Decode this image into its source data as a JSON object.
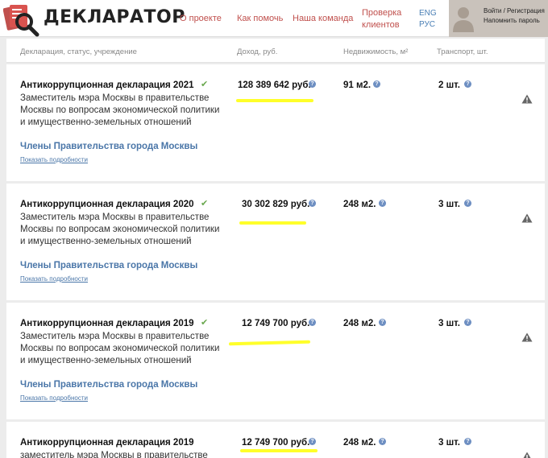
{
  "header": {
    "logo_text": "ДЕКЛАРАТОР",
    "nav": [
      "О проекте",
      "Как помочь",
      "Наша команда",
      "Проверка клиентов"
    ],
    "lang": [
      "ENG",
      "РУС"
    ],
    "login": "Войти / Регистрация",
    "remind": "Напомнить пароль",
    "colors": {
      "nav": "#c0504d",
      "lang": "#4a7fb5",
      "user_box": "#c9c2bb"
    }
  },
  "table": {
    "columns": [
      "Декларация, статус, учреждение",
      "Доход, руб.",
      "Недвижимость, м²",
      "Транспорт, шт."
    ],
    "rows": [
      {
        "title": "Антикоррупционная декларация 2021",
        "verified": "✔",
        "desc": "Заместитель мэра Москвы в правительстве Москвы по вопросам экономической политики и имущественно-земельных отношений",
        "group": "Члены Правительства города Москвы",
        "more": "Показать подробности",
        "income": "128 389 642 руб.",
        "realty": "91 м2.",
        "transport": "2 шт."
      },
      {
        "title": "Антикоррупционная декларация 2020",
        "verified": "✔",
        "desc": "Заместитель мэра Москвы в правительстве Москвы по вопросам экономической политики и имущественно-земельных отношений",
        "group": "Члены Правительства города Москвы",
        "more": "Показать подробности",
        "income": "30 302 829 руб.",
        "realty": "248 м2.",
        "transport": "3 шт."
      },
      {
        "title": "Антикоррупционная декларация 2019",
        "verified": "✔",
        "desc": "Заместитель мэра Москвы в правительстве Москвы по вопросам экономической политики и имущественно-земельных отношений",
        "group": "Члены Правительства города Москвы",
        "more": "Показать подробности",
        "income": "12 749 700 руб.",
        "realty": "248 м2.",
        "transport": "3 шт."
      },
      {
        "title": "Антикоррупционная декларация 2019",
        "desc_first_line": "заместитель мэра Москвы в правительстве",
        "income": "12 749 700 руб.",
        "realty": "248 м2.",
        "transport": "3 шт."
      }
    ],
    "colors": {
      "group": "#4a76a8",
      "highlight": "#ffff2a",
      "check": "#6aa84f"
    }
  }
}
